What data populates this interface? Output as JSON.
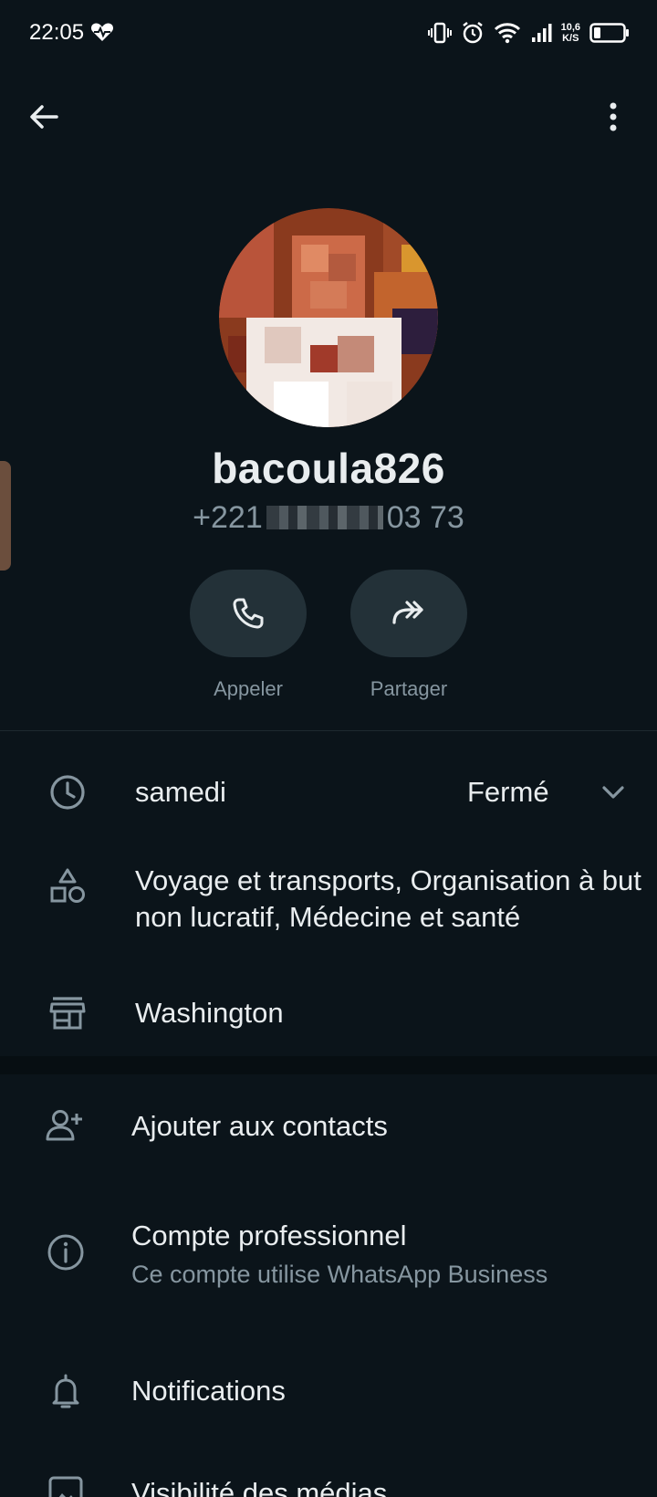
{
  "status_bar": {
    "time": "22:05",
    "net_speed_value": "10,6",
    "net_speed_unit": "K/S"
  },
  "toolbar": {
    "back_icon": "arrow-left-icon",
    "menu_icon": "more-vertical-icon"
  },
  "profile": {
    "name": "bacoula826",
    "phone_prefix": "+221",
    "phone_suffix": "03 73"
  },
  "actions": [
    {
      "label": "Appeler",
      "icon": "phone-icon"
    },
    {
      "label": "Partager",
      "icon": "share-forward-icon"
    }
  ],
  "business": {
    "hours_day": "samedi",
    "hours_status": "Fermé",
    "categories": "Voyage et transports, Organisation à but non lucratif, Médecine et santé",
    "location": "Washington"
  },
  "options": {
    "add_contact": "Ajouter aux contacts",
    "business_account_title": "Compte professionnel",
    "business_account_sub": "Ce compte utilise WhatsApp Business",
    "notifications": "Notifications",
    "media_visibility": "Visibilité des médias"
  },
  "colors": {
    "background": "#0b141a",
    "surface": "#233138",
    "text_primary": "#e9edef",
    "text_secondary": "#8696a0"
  }
}
